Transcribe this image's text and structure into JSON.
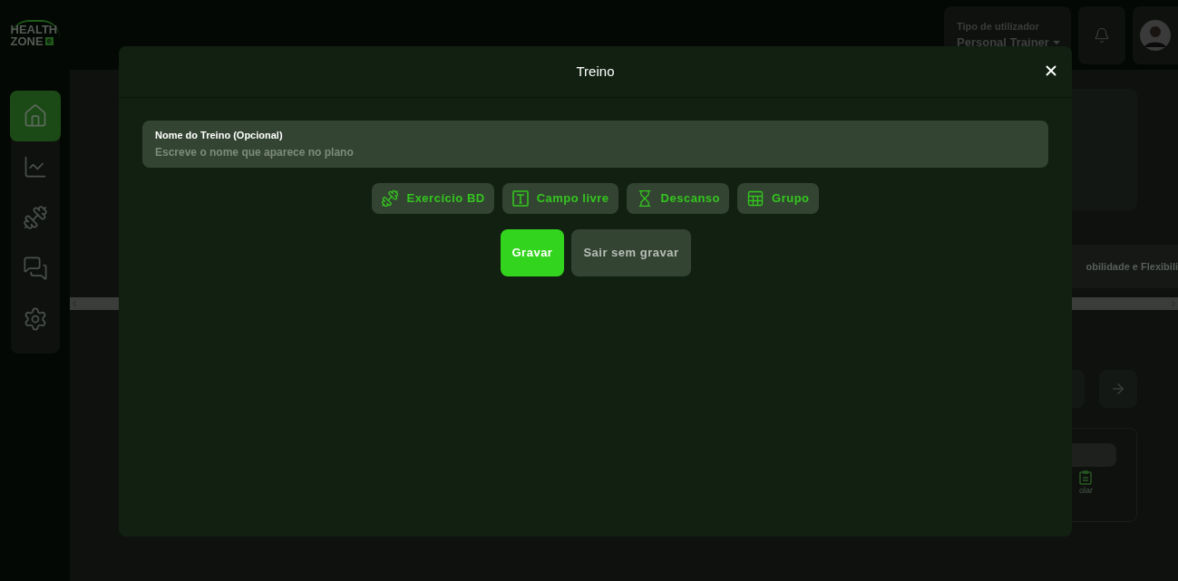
{
  "logo": {
    "line1": "HEALTH",
    "line2": "ZONE",
    "badge": "e"
  },
  "sidebar": {
    "items": [
      {
        "kind": "home",
        "selected": true
      },
      {
        "kind": "stats",
        "selected": false
      },
      {
        "kind": "workouts",
        "selected": false
      },
      {
        "kind": "messages",
        "selected": false
      },
      {
        "kind": "settings",
        "selected": false
      }
    ]
  },
  "header": {
    "user_type_label": "Tipo de utilizador",
    "user_type_value": "Personal Trainer"
  },
  "background": {
    "tab_text": "obilidade e Flexibili",
    "card_action": "olar"
  },
  "modal": {
    "title": "Treino",
    "name_field": {
      "label": "Nome do Treino (Opcional)",
      "placeholder": "Escreve o nome que aparece no plano"
    },
    "tools": [
      {
        "kind": "exercise",
        "label": "Exercício BD"
      },
      {
        "kind": "text",
        "label": "Campo livre"
      },
      {
        "kind": "rest",
        "label": "Descanso"
      },
      {
        "kind": "group",
        "label": "Grupo"
      }
    ],
    "actions": [
      {
        "kind": "primary",
        "label": "Gravar"
      },
      {
        "kind": "secondary",
        "label": "Sair sem gravar"
      }
    ]
  }
}
